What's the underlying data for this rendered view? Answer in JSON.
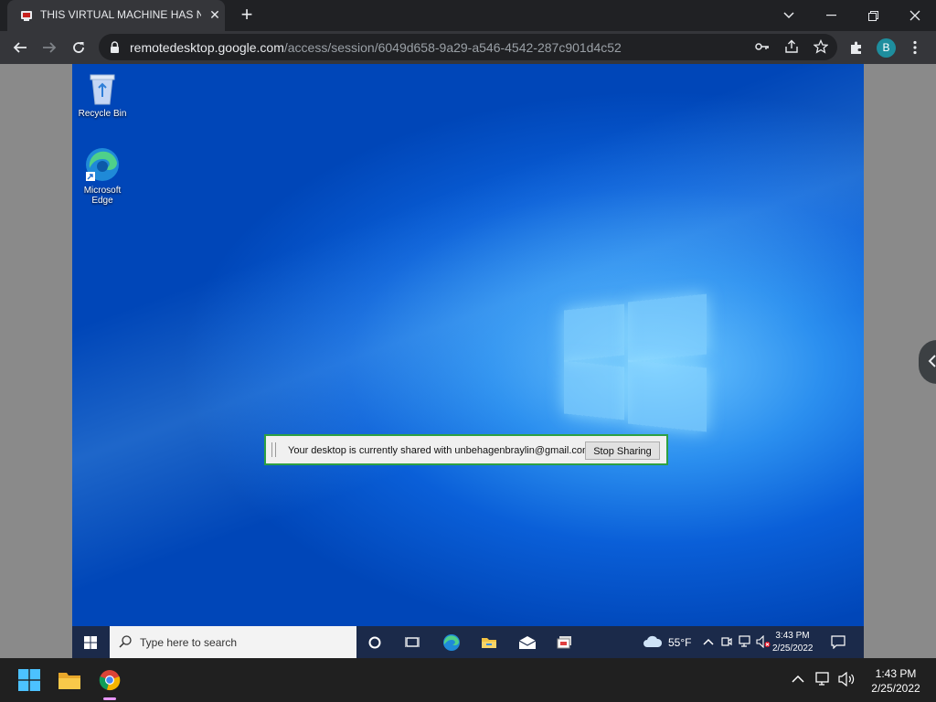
{
  "browser": {
    "tab_title": "THIS VIRTUAL MACHINE HAS NO",
    "new_tab": "+",
    "url_host": "remotedesktop.google.com",
    "url_path": "/access/session/6049d658-9a29-a546-4542-287c901d4c52",
    "profile_initial": "B"
  },
  "desktop": {
    "icons": [
      {
        "label": "Recycle Bin"
      },
      {
        "label": "Microsoft Edge"
      }
    ],
    "share_bar": {
      "message": "Your desktop is currently shared with unbehagenbraylin@gmail.com",
      "stop_label": "Stop Sharing"
    }
  },
  "remote_taskbar": {
    "search_placeholder": "Type here to search",
    "weather": "55°F",
    "time": "3:43 PM",
    "date": "2/25/2022"
  },
  "host_taskbar": {
    "time": "1:43 PM",
    "date": "2/25/2022"
  },
  "colors": {
    "accent_green": "#2ea043",
    "profile": "#1e8e9e"
  }
}
